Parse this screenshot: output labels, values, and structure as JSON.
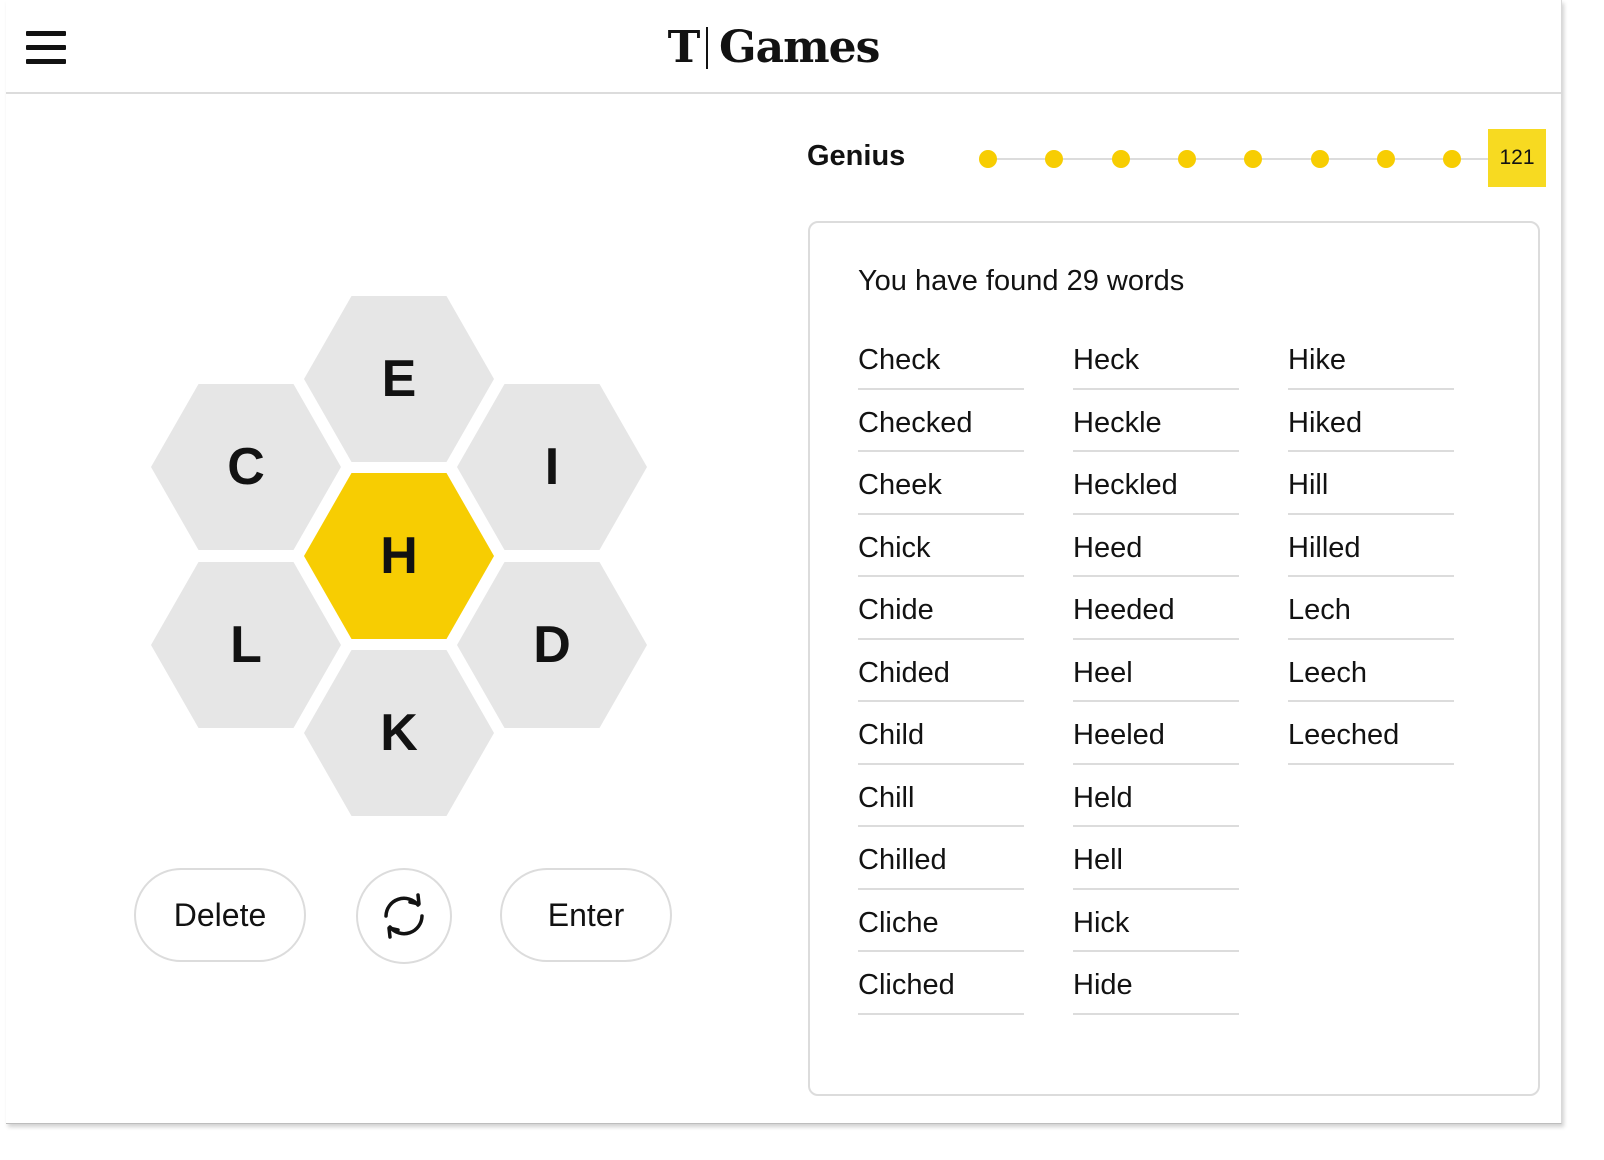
{
  "header": {
    "logo_mark": "T",
    "logo_text": "Games",
    "menu_icon": "hamburger-icon"
  },
  "progress": {
    "rank": "Genius",
    "score": "121",
    "steps_reached": 9,
    "dot_color": "#f7cd02",
    "score_color": "#f7da21"
  },
  "hive": {
    "center_letter": "H",
    "outer_letters": [
      "E",
      "C",
      "I",
      "L",
      "D",
      "K"
    ],
    "center_color": "#f7cd02",
    "outer_color": "#e6e6e6"
  },
  "controls": {
    "delete_label": "Delete",
    "shuffle_icon": "shuffle-icon",
    "enter_label": "Enter"
  },
  "wordlist": {
    "summary": "You have found 29 words",
    "columns": [
      [
        "Check",
        "Checked",
        "Cheek",
        "Chick",
        "Chide",
        "Chided",
        "Child",
        "Chill",
        "Chilled",
        "Cliche",
        "Cliched"
      ],
      [
        "Heck",
        "Heckle",
        "Heckled",
        "Heed",
        "Heeded",
        "Heel",
        "Heeled",
        "Held",
        "Hell",
        "Hick",
        "Hide"
      ],
      [
        "Hike",
        "Hiked",
        "Hill",
        "Hilled",
        "Lech",
        "Leech",
        "Leeched"
      ]
    ]
  }
}
